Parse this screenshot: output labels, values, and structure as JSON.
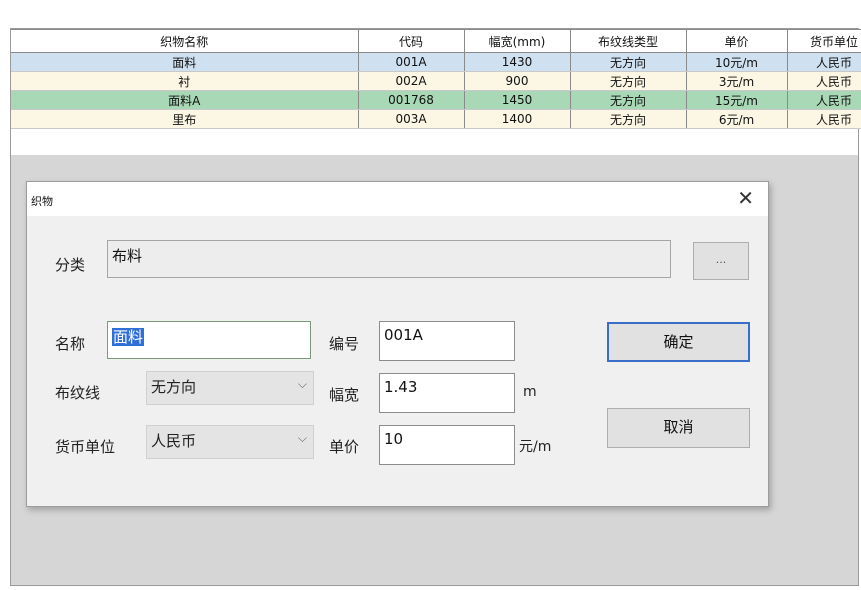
{
  "table": {
    "columns": [
      "织物名称",
      "代码",
      "幅宽(mm)",
      "布纹线类型",
      "单价",
      "货币单位"
    ],
    "rows": [
      [
        "面料",
        "001A",
        "1430",
        "无方向",
        "10元/m",
        "人民币"
      ],
      [
        "衬",
        "002A",
        "900",
        "无方向",
        "3元/m",
        "人民币"
      ],
      [
        "面料A",
        "001768",
        "1450",
        "无方向",
        "15元/m",
        "人民币"
      ],
      [
        "里布",
        "003A",
        "1400",
        "无方向",
        "6元/m",
        "人民币"
      ]
    ]
  },
  "dialog": {
    "title": "织物",
    "close_glyph": "✕",
    "category_label": "分类",
    "category_value": "布料",
    "browse_label": "...",
    "name_label": "名称",
    "name_value": "面料",
    "grain_label": "布纹线",
    "grain_value": "无方向",
    "currency_label": "货币单位",
    "currency_value": "人民币",
    "code_label": "编号",
    "code_value": "001A",
    "width_label": "幅宽",
    "width_value": "1.43",
    "width_unit": "m",
    "price_label": "单价",
    "price_value": "10",
    "price_unit": "元/m",
    "ok_label": "确定",
    "cancel_label": "取消",
    "dropdown_glyph": "⌵"
  },
  "colors": {
    "row_selected": "#cfe0f0",
    "row_alt": "#fbf7e4",
    "row_highlight": "#a9d8b6",
    "text_selection": "#2f6fd6",
    "default_button_border": "#3a6fc9"
  }
}
